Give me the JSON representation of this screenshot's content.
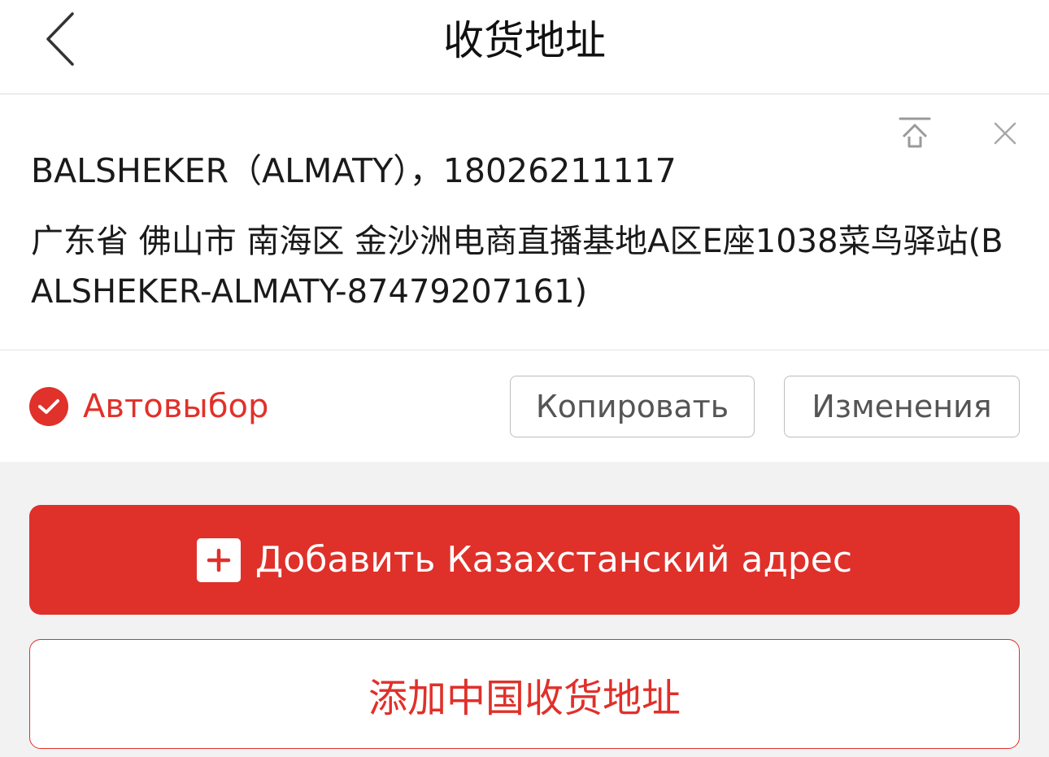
{
  "nav": {
    "back_icon": "chevron-left-icon",
    "title": "收货地址"
  },
  "address_card": {
    "pin_icon": "pin-to-top-icon",
    "close_icon": "close-icon",
    "contact_line": "BALSHEKER（ALMATY），18026211117",
    "address_line": "广东省 佛山市 南海区 金沙洲电商直播基地A区E座1038菜鸟驿站(BALSHEKER-ALMATY-87479207161)",
    "auto_select": {
      "checked": true,
      "label": "Автовыбор"
    },
    "copy_button": "Копировать",
    "edit_button": "Изменения"
  },
  "actions": {
    "add_kazakhstan_address": "Добавить Казахстанский адрес",
    "add_china_address": "添加中国收货地址"
  },
  "colors": {
    "accent": "#e0302a",
    "background": "#f2f2f2",
    "card": "#ffffff"
  }
}
